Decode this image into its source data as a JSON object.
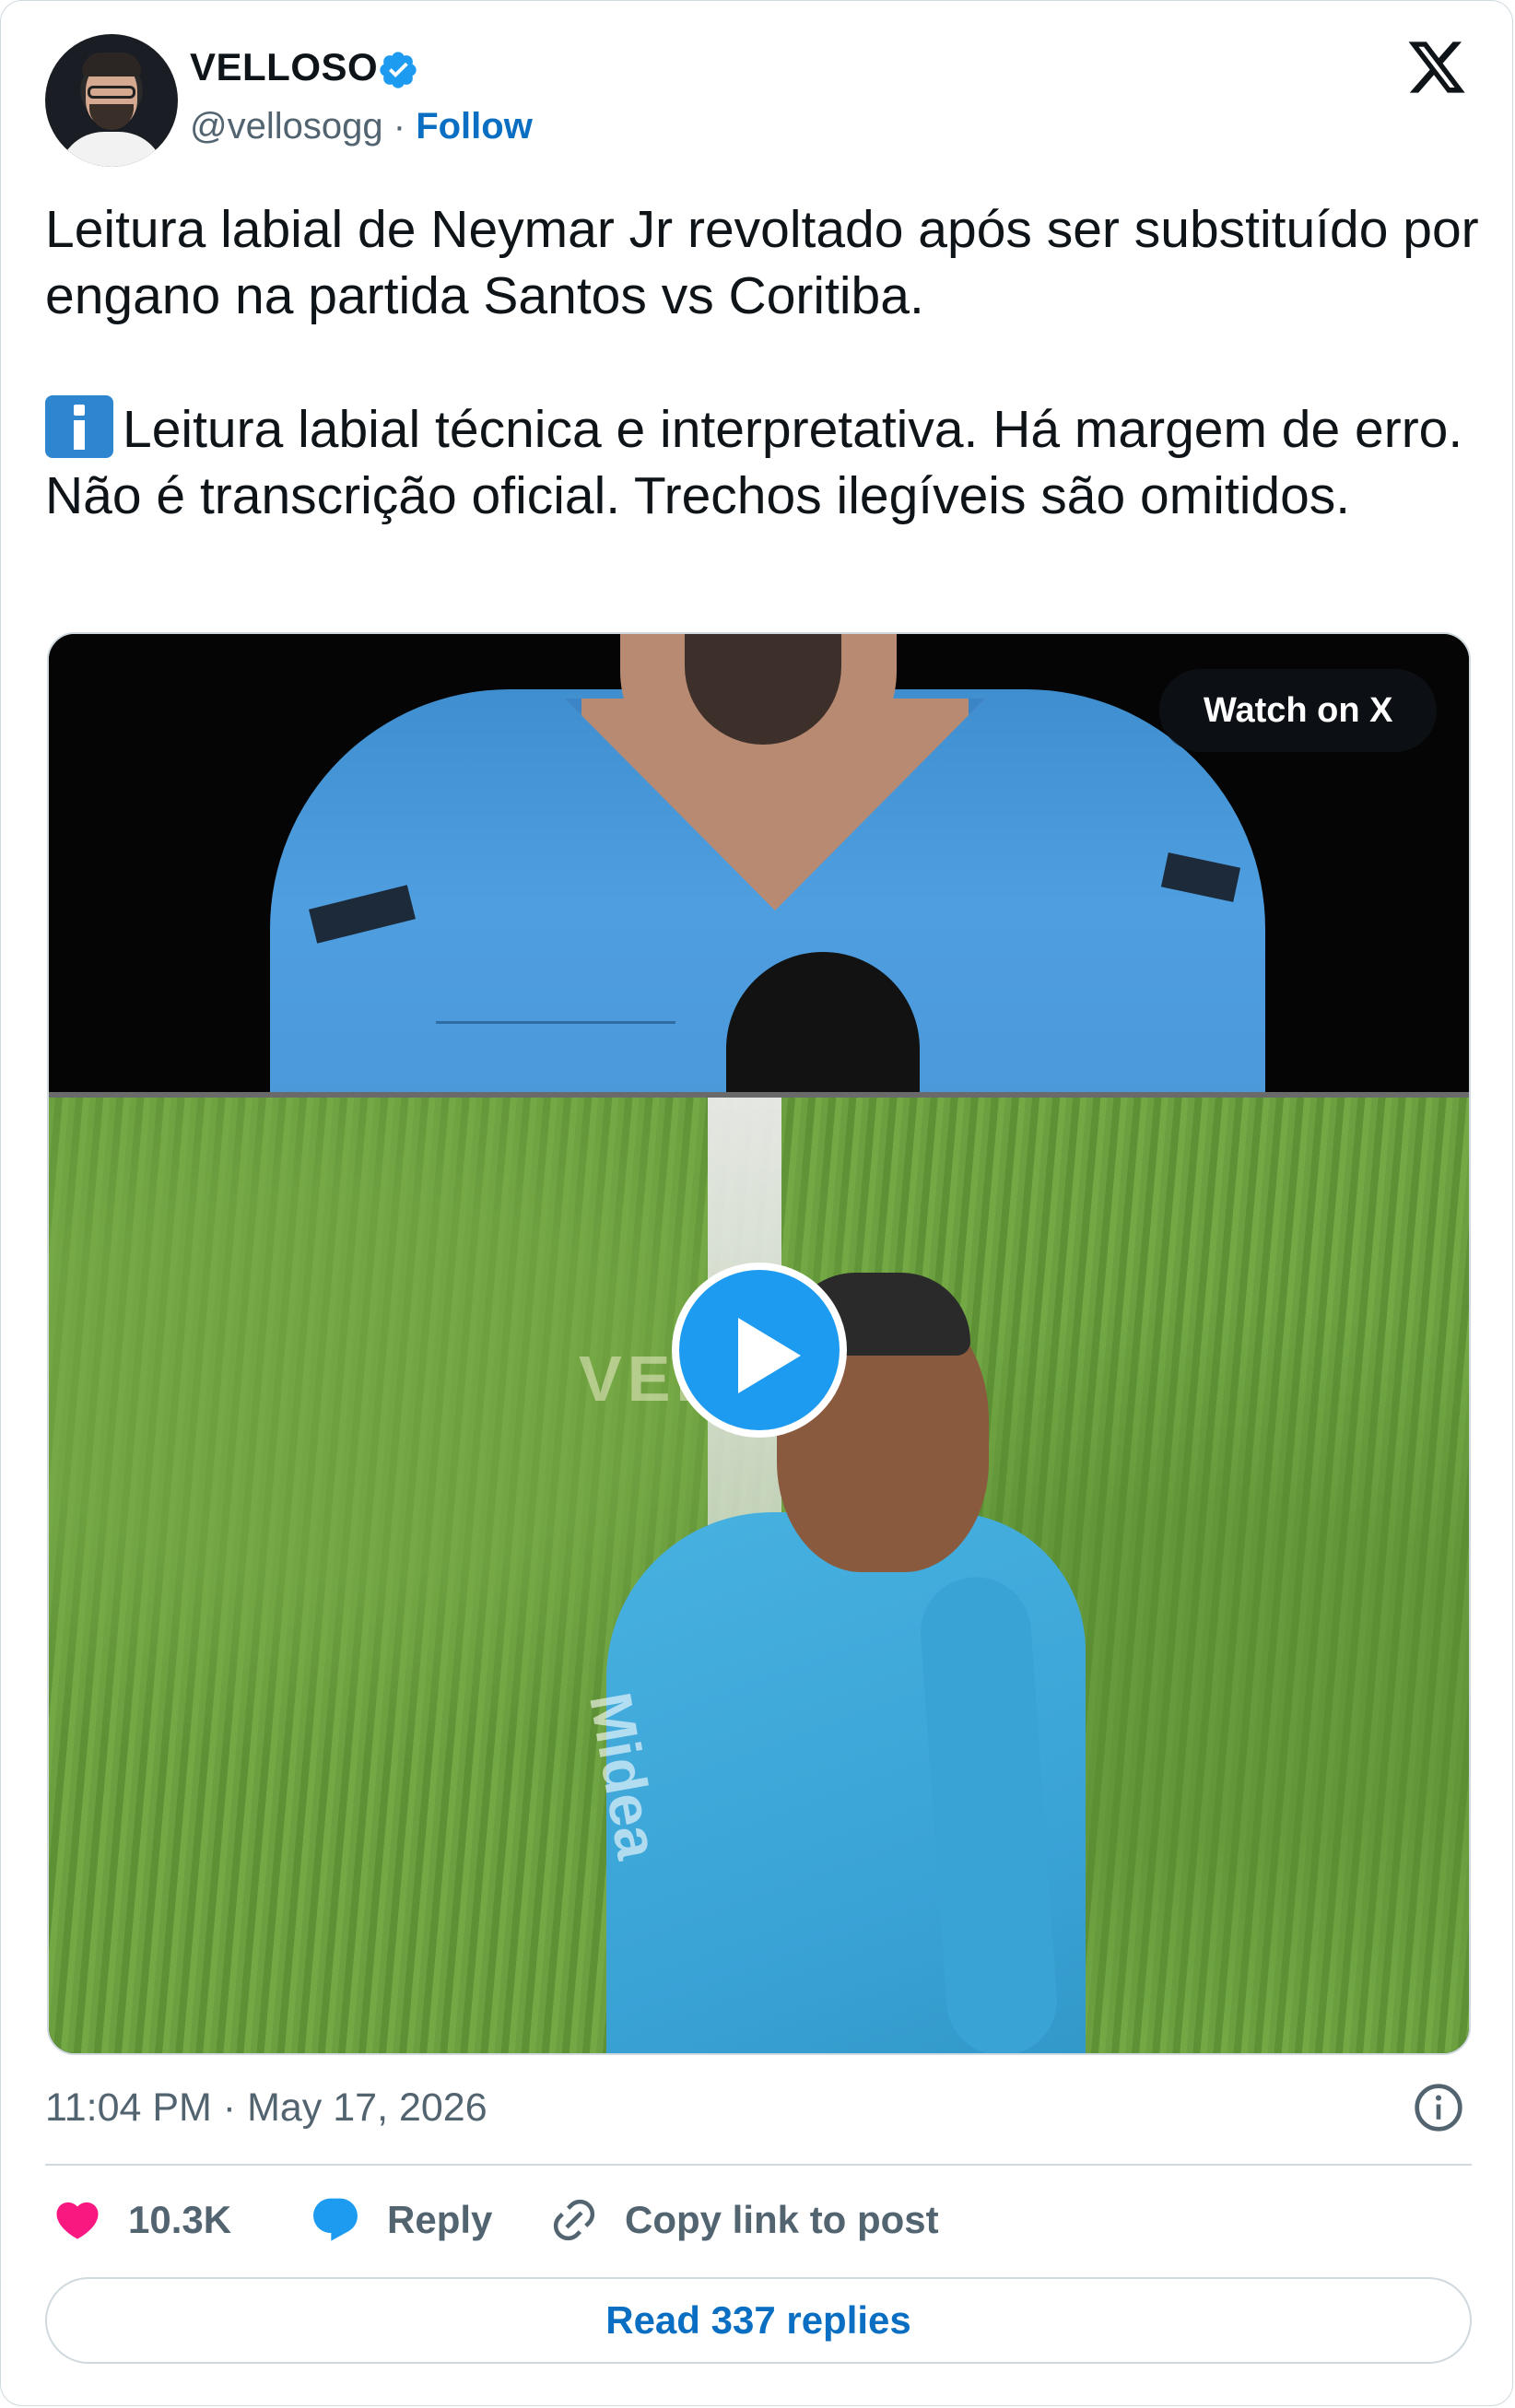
{
  "author": {
    "name": "VELLOSO",
    "handle": "@vellosogg",
    "separator": "·",
    "follow_label": "Follow",
    "verified": true
  },
  "post": {
    "text_line1": "Leitura labial de Neymar Jr revoltado após ser substituído por engano na partida Santos vs Coritiba.",
    "info_emoji": "information-emoji",
    "text_line2": "Leitura labial técnica e interpretativa. Há margem de erro. Não é transcrição oficial. Trechos ilegíveis são omitidos."
  },
  "media": {
    "watch_label": "Watch on X",
    "watermark_text": "VELLOSO",
    "sponsor_text": "Midea"
  },
  "timestamp": "11:04 PM · May 17, 2026",
  "actions": {
    "like_count": "10.3K",
    "reply_label": "Reply",
    "copy_label": "Copy link to post"
  },
  "read_replies_label": "Read 337 replies",
  "colors": {
    "accent": "#1d9bf0",
    "link": "#0a6fc2",
    "like": "#f91880",
    "muted": "#536471",
    "border": "#cfd9de"
  }
}
